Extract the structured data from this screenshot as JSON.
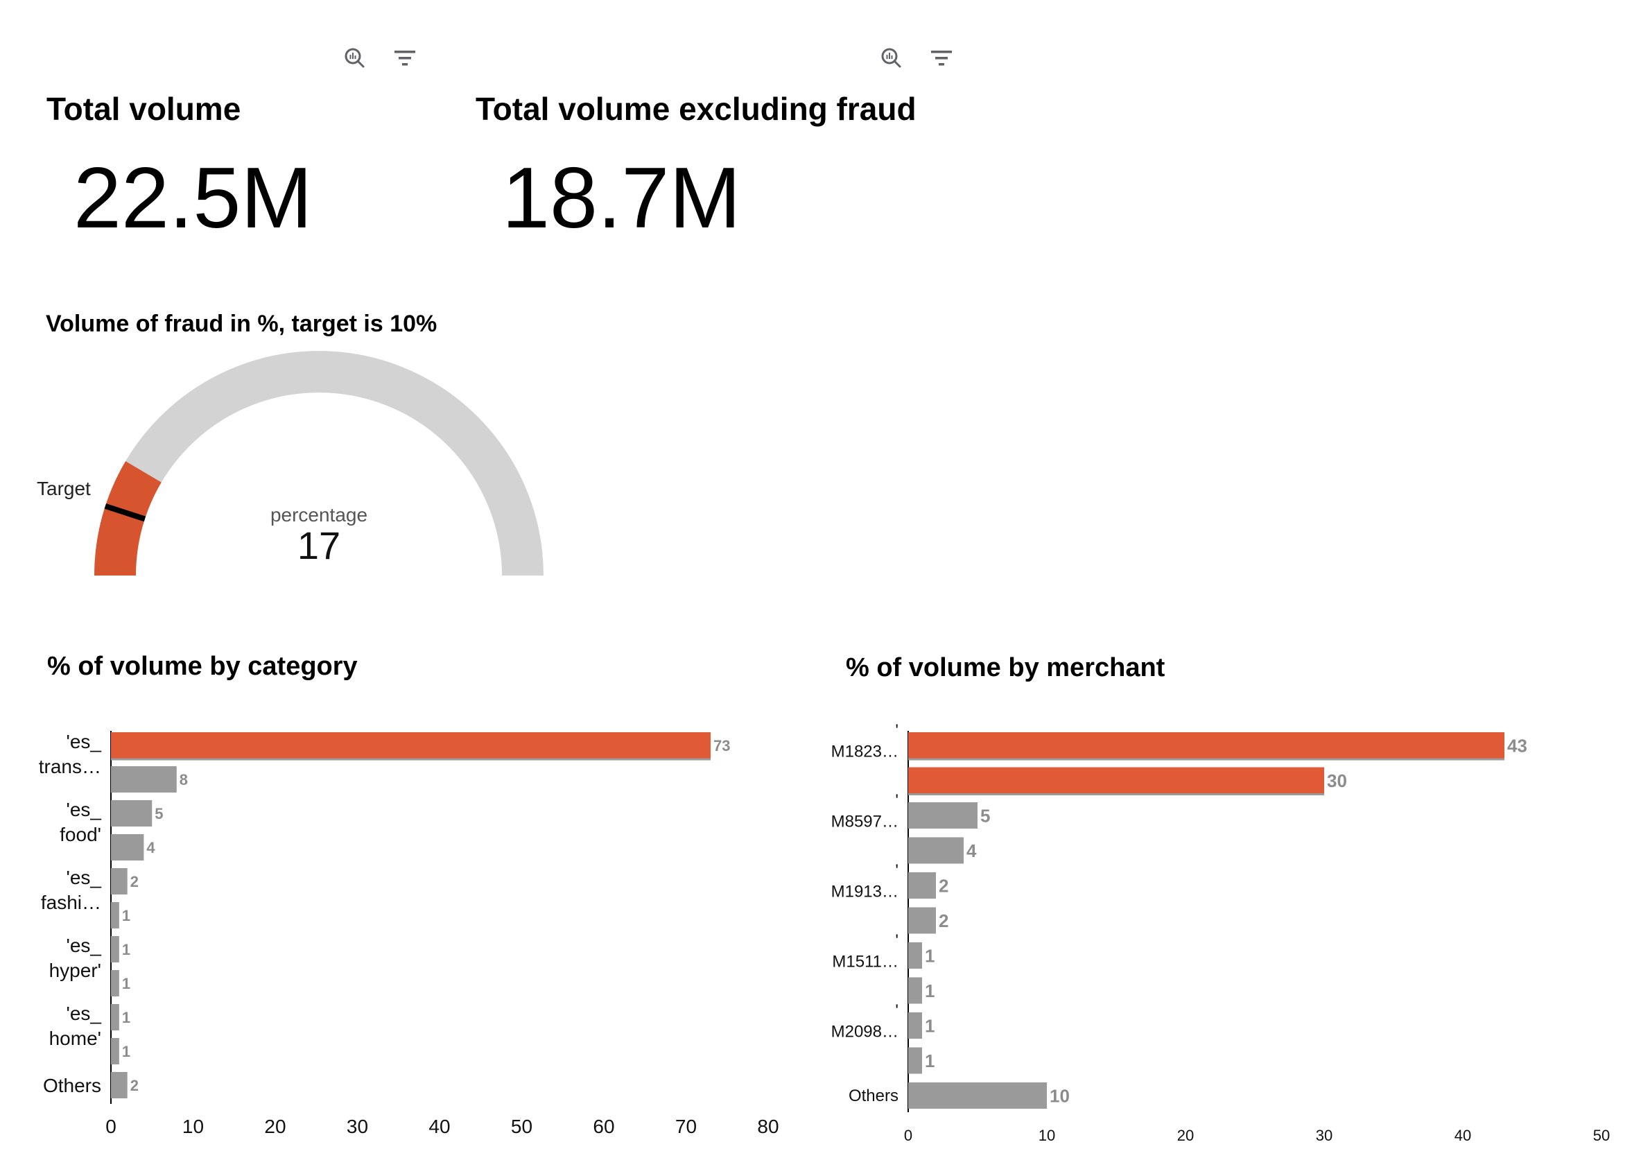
{
  "kpis": [
    {
      "title": "Total volume",
      "value": "22.5M"
    },
    {
      "title": "Total volume excluding fraud",
      "value": "18.7M"
    }
  ],
  "icons": [
    "zoom-analytics-icon",
    "filter-icon"
  ],
  "colors": {
    "accent": "#e05a35",
    "bar": "#9a9a9a",
    "gauge_track": "#d3d3d3",
    "gauge_fill": "#d6552f",
    "target_line": "#000000"
  },
  "gauge": {
    "title": "Volume of fraud in %, target is 10%",
    "label": "percentage",
    "value": 17,
    "display_value": "17",
    "min": 0,
    "max": 100,
    "target": 10,
    "target_label": "Target"
  },
  "chart_data": [
    {
      "type": "bar",
      "orientation": "horizontal",
      "title": "% of volume by category",
      "categories": [
        "'es_ trans…",
        "",
        "'es_ food'",
        "",
        "'es_ fashi…",
        "",
        "'es_ hyper'",
        "",
        "'es_ home'",
        "",
        "Others"
      ],
      "values": [
        73,
        8,
        5,
        4,
        2,
        1,
        1,
        1,
        1,
        1,
        2
      ],
      "highlighted": [
        true,
        false,
        false,
        false,
        false,
        false,
        false,
        false,
        false,
        false,
        false
      ],
      "xlim": [
        0,
        80
      ],
      "xticks": [
        "0",
        "10",
        "20",
        "30",
        "40",
        "50",
        "60",
        "70",
        "80"
      ],
      "grid": false
    },
    {
      "type": "bar",
      "orientation": "horizontal",
      "title": "% of volume by merchant",
      "categories": [
        "' M1823…",
        "",
        "' M8597…",
        "",
        "' M1913…",
        "",
        "' M1511…",
        "",
        "' M2098…",
        "",
        "Others"
      ],
      "values": [
        43,
        30,
        5,
        4,
        2,
        2,
        1,
        1,
        1,
        1,
        10
      ],
      "highlighted": [
        true,
        true,
        false,
        false,
        false,
        false,
        false,
        false,
        false,
        false,
        false
      ],
      "xlim": [
        0,
        50
      ],
      "xticks": [
        "0",
        "10",
        "20",
        "30",
        "40",
        "50"
      ],
      "grid": false
    }
  ]
}
